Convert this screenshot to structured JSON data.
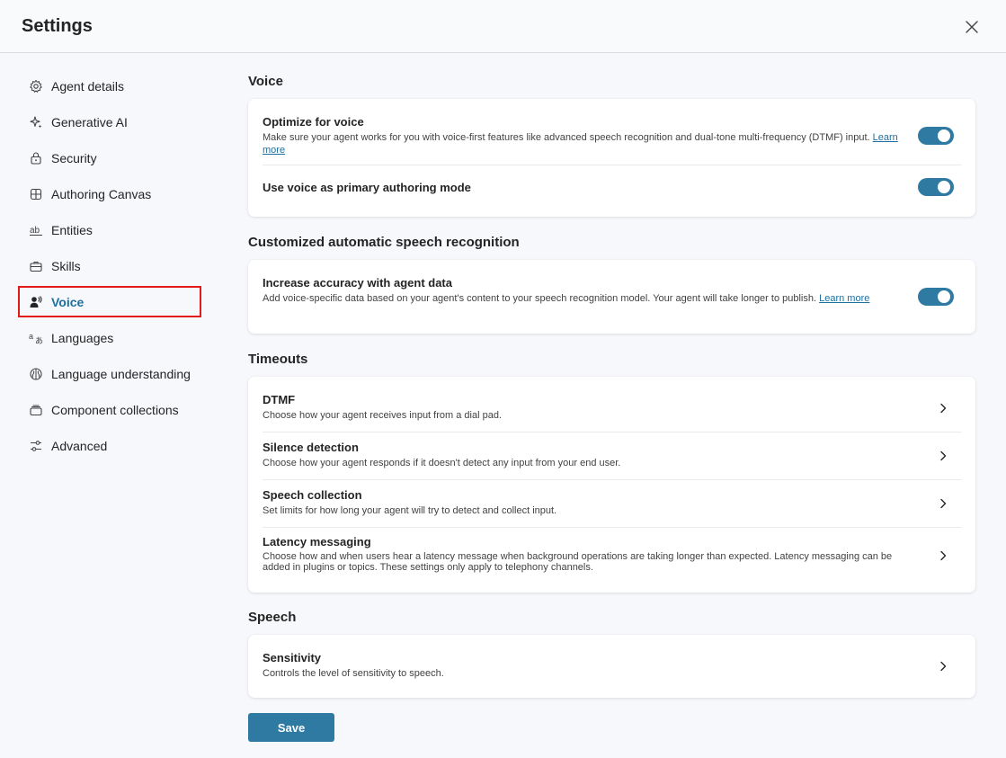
{
  "header": {
    "title": "Settings"
  },
  "sidebar": {
    "items": [
      {
        "label": "Agent details",
        "icon": "gear-icon"
      },
      {
        "label": "Generative AI",
        "icon": "sparkle-icon"
      },
      {
        "label": "Security",
        "icon": "lock-icon"
      },
      {
        "label": "Authoring Canvas",
        "icon": "grid-icon"
      },
      {
        "label": "Entities",
        "icon": "text-ab-icon"
      },
      {
        "label": "Skills",
        "icon": "briefcase-icon"
      },
      {
        "label": "Voice",
        "icon": "person-voice-icon",
        "active": true
      },
      {
        "label": "Languages",
        "icon": "translate-icon"
      },
      {
        "label": "Language understanding",
        "icon": "brain-icon"
      },
      {
        "label": "Component collections",
        "icon": "collection-icon"
      },
      {
        "label": "Advanced",
        "icon": "options-icon"
      }
    ]
  },
  "voice_section": {
    "title": "Voice",
    "optimize": {
      "title": "Optimize for voice",
      "desc": "Make sure your agent works for you with voice-first features like advanced speech recognition and dual-tone multi-frequency (DTMF) input.",
      "link": "Learn more",
      "enabled": true
    },
    "primary_mode": {
      "title": "Use voice as primary authoring mode",
      "enabled": true
    }
  },
  "asr_section": {
    "title": "Customized automatic speech recognition",
    "accuracy": {
      "title": "Increase accuracy with agent data",
      "desc": "Add voice-specific data based on your agent's content to your speech recognition model. Your agent will take longer to publish.",
      "link": "Learn more",
      "enabled": true
    }
  },
  "timeouts_section": {
    "title": "Timeouts",
    "rows": [
      {
        "title": "DTMF",
        "desc": "Choose how your agent receives input from a dial pad."
      },
      {
        "title": "Silence detection",
        "desc": "Choose how your agent responds if it doesn't detect any input from your end user."
      },
      {
        "title": "Speech collection",
        "desc": "Set limits for how long your agent will try to detect and collect input."
      },
      {
        "title": "Latency messaging",
        "desc": "Choose how and when users hear a latency message when background operations are taking longer than expected. Latency messaging can be added in plugins or topics. These settings only apply to telephony channels."
      }
    ]
  },
  "speech_section": {
    "title": "Speech",
    "sensitivity": {
      "title": "Sensitivity",
      "desc": "Controls the level of sensitivity to speech."
    }
  },
  "footer": {
    "save_label": "Save"
  },
  "colors": {
    "accent": "#2f7aa3",
    "active_outline": "#e21a1a",
    "link": "#1f6f9e"
  }
}
